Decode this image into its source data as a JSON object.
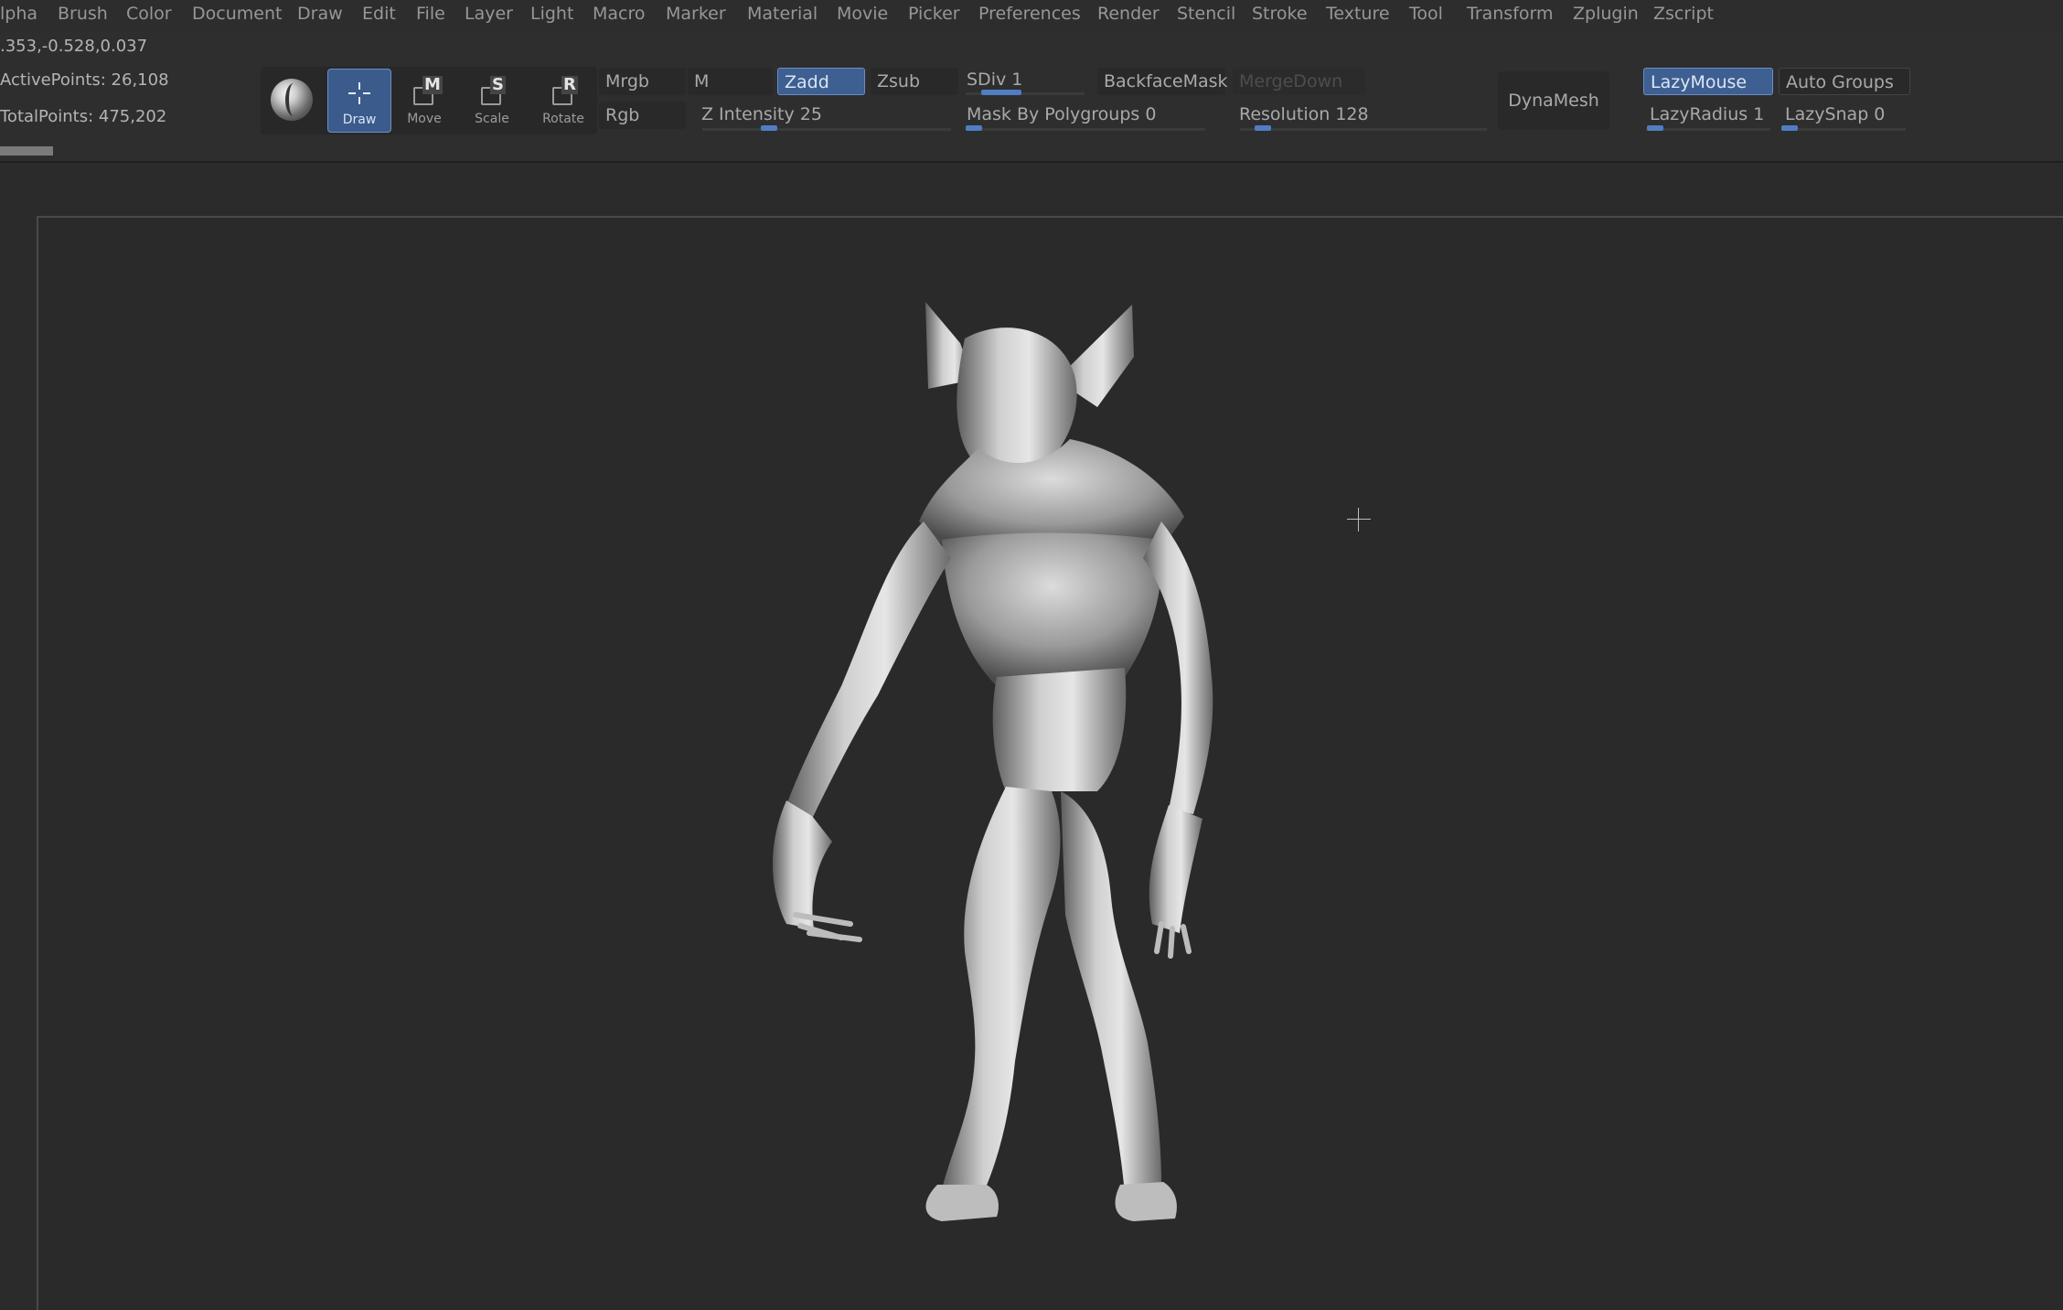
{
  "menu": {
    "items": [
      "lpha",
      "Brush",
      "Color",
      "Document",
      "Draw",
      "Edit",
      "File",
      "Layer",
      "Light",
      "Macro",
      "Marker",
      "Material",
      "Movie",
      "Picker",
      "Preferences",
      "Render",
      "Stencil",
      "Stroke",
      "Texture",
      "Tool",
      "Transform",
      "Zplugin",
      "Zscript"
    ]
  },
  "info": {
    "coords": ".353,-0.528,0.037",
    "active_points": "ActivePoints: 26,108",
    "total_points": "TotalPoints: 475,202"
  },
  "tools": {
    "material_icon": "material-sphere-icon",
    "draw": {
      "label": "Draw",
      "icon": "draw-crosshair-icon",
      "active": true
    },
    "move": {
      "label": "Move",
      "icon": "move-m-icon",
      "letter": "M"
    },
    "scale": {
      "label": "Scale",
      "icon": "scale-s-icon",
      "letter": "S"
    },
    "rotate": {
      "label": "Rotate",
      "icon": "rotate-r-icon",
      "letter": "R"
    }
  },
  "toolbar": {
    "mrgb": "Mrgb",
    "rgb": "Rgb",
    "m": "M",
    "zadd": "Zadd",
    "zsub": "Zsub",
    "z_intensity": "Z Intensity 25",
    "sdiv": "SDiv 1",
    "backface_mask": "BackfaceMask",
    "merge_down": "MergeDown",
    "mask_by_polygroups": "Mask By Polygroups 0",
    "resolution": "Resolution 128",
    "dynamesh": "DynaMesh",
    "lazymouse": "LazyMouse",
    "auto_groups": "Auto Groups",
    "lazy_radius": "LazyRadius 1",
    "lazy_snap": "LazySnap 0"
  },
  "sliders": {
    "z_intensity": 25,
    "sdiv": 1,
    "mask_by_polygroups": 0,
    "resolution": 128,
    "lazy_radius": 1,
    "lazy_snap": 0
  },
  "colors": {
    "accent": "#3d5f91",
    "accent_border": "#6c8dc2",
    "slider_knob": "#4f7ec2",
    "background": "#2b2b2b"
  },
  "viewport": {
    "cursor_icon": "crosshair-cursor-icon",
    "model_icon": "demon-sculpt-model"
  }
}
